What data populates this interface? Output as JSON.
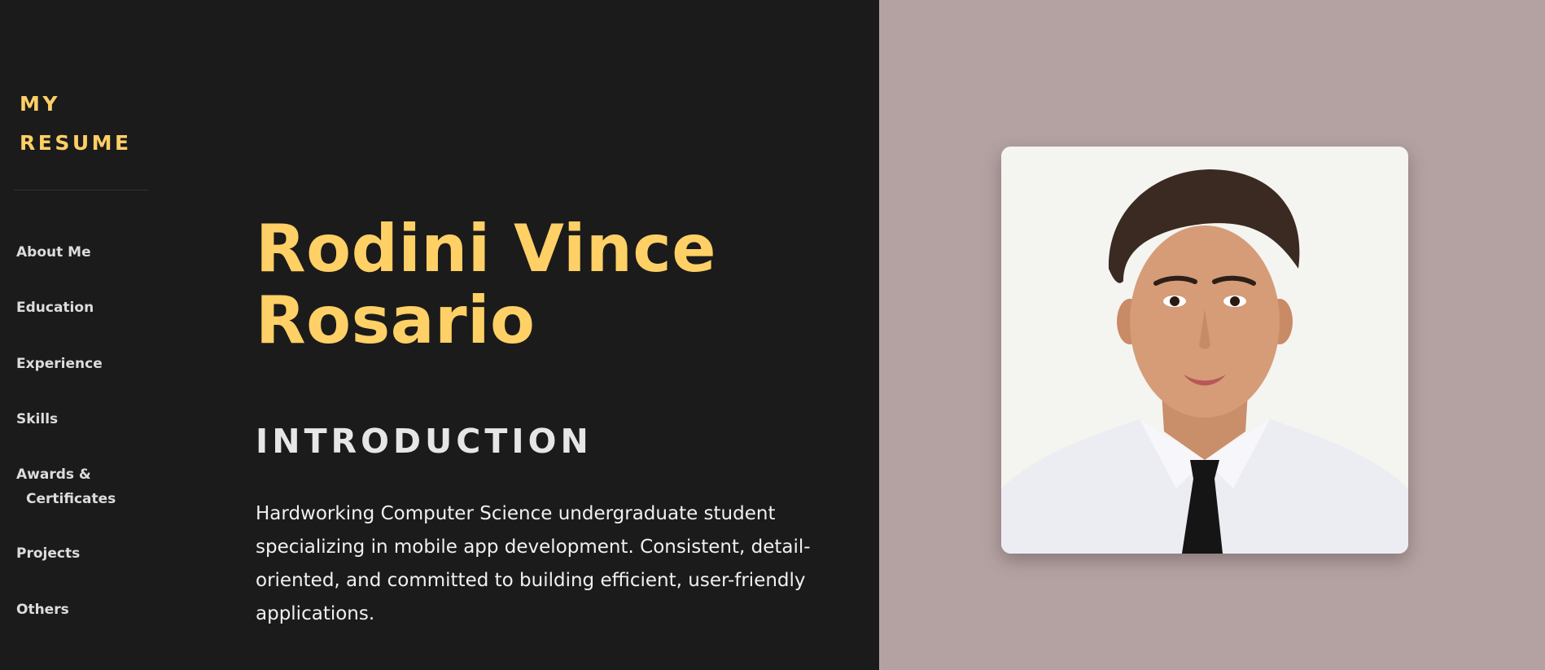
{
  "brand": {
    "line1": "MY",
    "line2": "RESUME"
  },
  "nav": {
    "about": "About Me",
    "education": "Education",
    "experience": "Experience",
    "skills": "Skills",
    "awards_line1": "Awards &",
    "awards_line2": "Certificates",
    "projects": "Projects",
    "others": "Others"
  },
  "profile": {
    "first_line": "Rodini Vince",
    "last_line": "Rosario",
    "section_title": "INTRODUCTION",
    "intro": "Hardworking Computer Science undergraduate student specializing in mobile app development. Consistent, detail-oriented, and committed to building efficient, user-friendly applications."
  },
  "colors": {
    "accent": "#ffd065",
    "background": "#1b1b1b",
    "photo_panel": "#b4a2a3"
  }
}
